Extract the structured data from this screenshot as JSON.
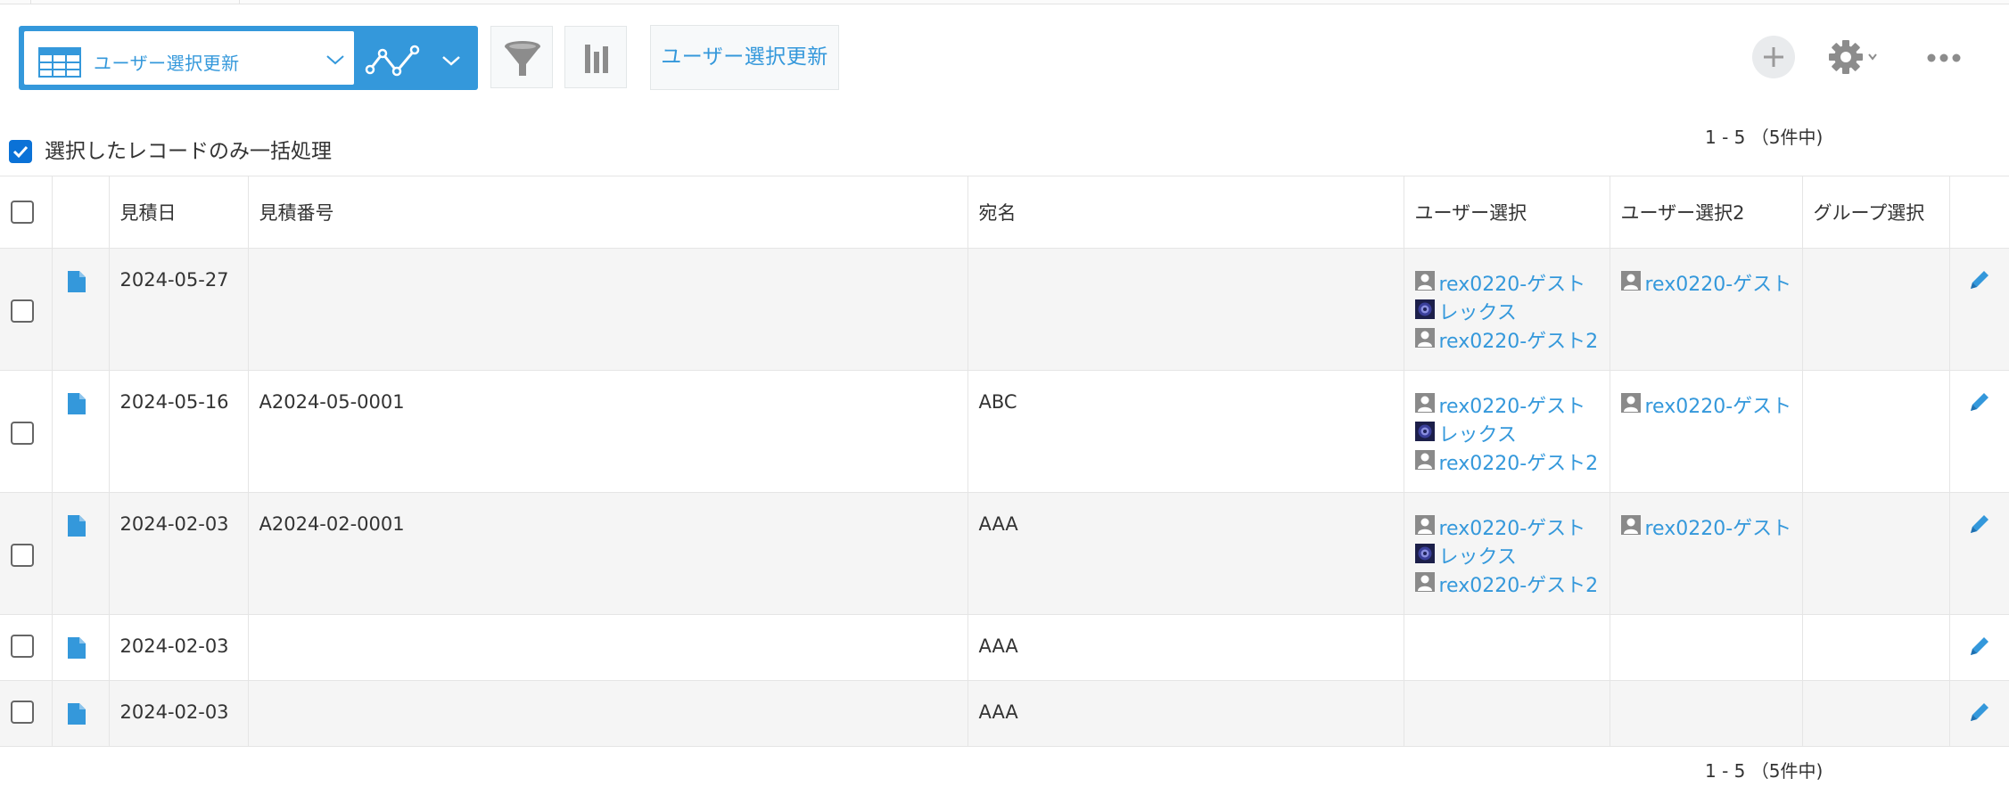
{
  "toolbar": {
    "view_name": "ユーザー選択更新",
    "custom_button_label": "ユーザー選択更新",
    "accent_color": "#3498db"
  },
  "bulk": {
    "checked": true,
    "label": "選択したレコードのみ一括処理"
  },
  "pagination": {
    "top": "1 - 5 （5件中)",
    "bottom": "1 - 5 （5件中)"
  },
  "table": {
    "columns": [
      "見積日",
      "見積番号",
      "宛名",
      "ユーザー選択",
      "ユーザー選択2",
      "グループ選択"
    ],
    "rows": [
      {
        "date": "2024-05-27",
        "number": "",
        "addressee": "",
        "users": [
          {
            "name": "rex0220-ゲスト",
            "icon": "person-icon"
          },
          {
            "name": "レックス",
            "icon": "avatar-icon"
          },
          {
            "name": "rex0220-ゲスト2",
            "icon": "person-icon"
          }
        ],
        "users2": [
          {
            "name": "rex0220-ゲスト",
            "icon": "person-icon"
          }
        ],
        "group": ""
      },
      {
        "date": "2024-05-16",
        "number": "A2024-05-0001",
        "addressee": "ABC",
        "users": [
          {
            "name": "rex0220-ゲスト",
            "icon": "person-icon"
          },
          {
            "name": "レックス",
            "icon": "avatar-icon"
          },
          {
            "name": "rex0220-ゲスト2",
            "icon": "person-icon"
          }
        ],
        "users2": [
          {
            "name": "rex0220-ゲスト",
            "icon": "person-icon"
          }
        ],
        "group": ""
      },
      {
        "date": "2024-02-03",
        "number": "A2024-02-0001",
        "addressee": "AAA",
        "users": [
          {
            "name": "rex0220-ゲスト",
            "icon": "person-icon"
          },
          {
            "name": "レックス",
            "icon": "avatar-icon"
          },
          {
            "name": "rex0220-ゲスト2",
            "icon": "person-icon"
          }
        ],
        "users2": [
          {
            "name": "rex0220-ゲスト",
            "icon": "person-icon"
          }
        ],
        "group": ""
      },
      {
        "date": "2024-02-03",
        "number": "",
        "addressee": "AAA",
        "users": [],
        "users2": [],
        "group": ""
      },
      {
        "date": "2024-02-03",
        "number": "",
        "addressee": "AAA",
        "users": [],
        "users2": [],
        "group": ""
      }
    ]
  }
}
